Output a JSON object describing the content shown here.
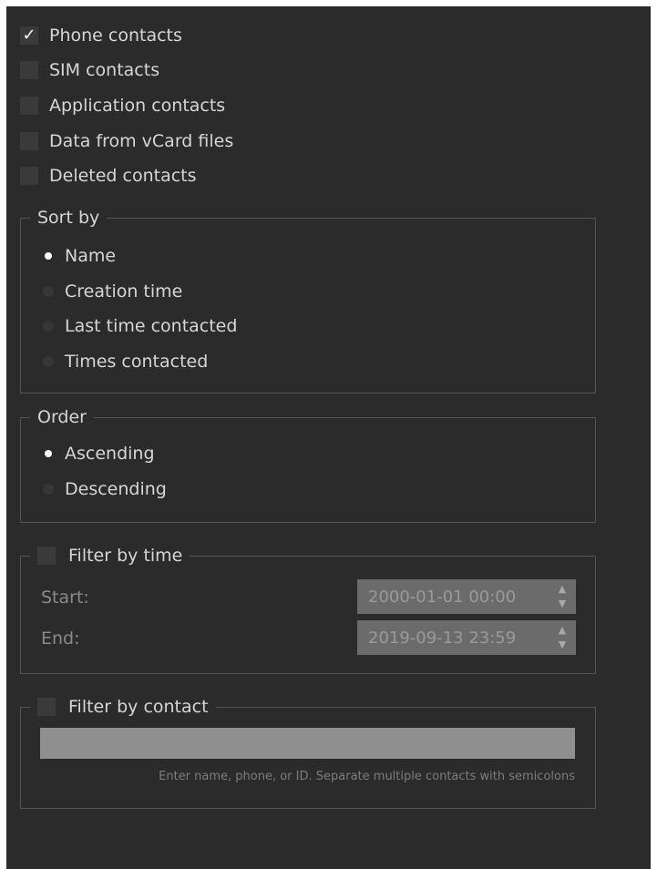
{
  "sources": [
    {
      "label": "Phone contacts",
      "checked": true
    },
    {
      "label": "SIM contacts",
      "checked": false
    },
    {
      "label": "Application contacts",
      "checked": false
    },
    {
      "label": "Data from vCard files",
      "checked": false
    },
    {
      "label": "Deleted contacts",
      "checked": false
    }
  ],
  "sort_by": {
    "title": "Sort by",
    "options": [
      "Name",
      "Creation time",
      "Last time contacted",
      "Times contacted"
    ],
    "selected": "Name"
  },
  "order": {
    "title": "Order",
    "options": [
      "Ascending",
      "Descending"
    ],
    "selected": "Ascending"
  },
  "filter_time": {
    "title": "Filter by time",
    "enabled": false,
    "start_label": "Start:",
    "start_value": "2000-01-01 00:00",
    "end_label": "End:",
    "end_value": "2019-09-13 23:59"
  },
  "filter_contact": {
    "title": "Filter by contact",
    "enabled": false,
    "value": "",
    "hint": "Enter name, phone, or ID. Separate multiple contacts with semicolons"
  },
  "icons": {
    "check": "check-icon",
    "spin_up": "triangle-up-icon",
    "spin_down": "triangle-down-icon"
  },
  "colors": {
    "background": "#2b2b2b",
    "text": "#d6d6d6",
    "disabled_text": "#8a8a8a",
    "control": "#3a3a3a",
    "border": "#555555",
    "input_disabled": "#6b6b6b",
    "text_input": "#8f8f8f"
  }
}
